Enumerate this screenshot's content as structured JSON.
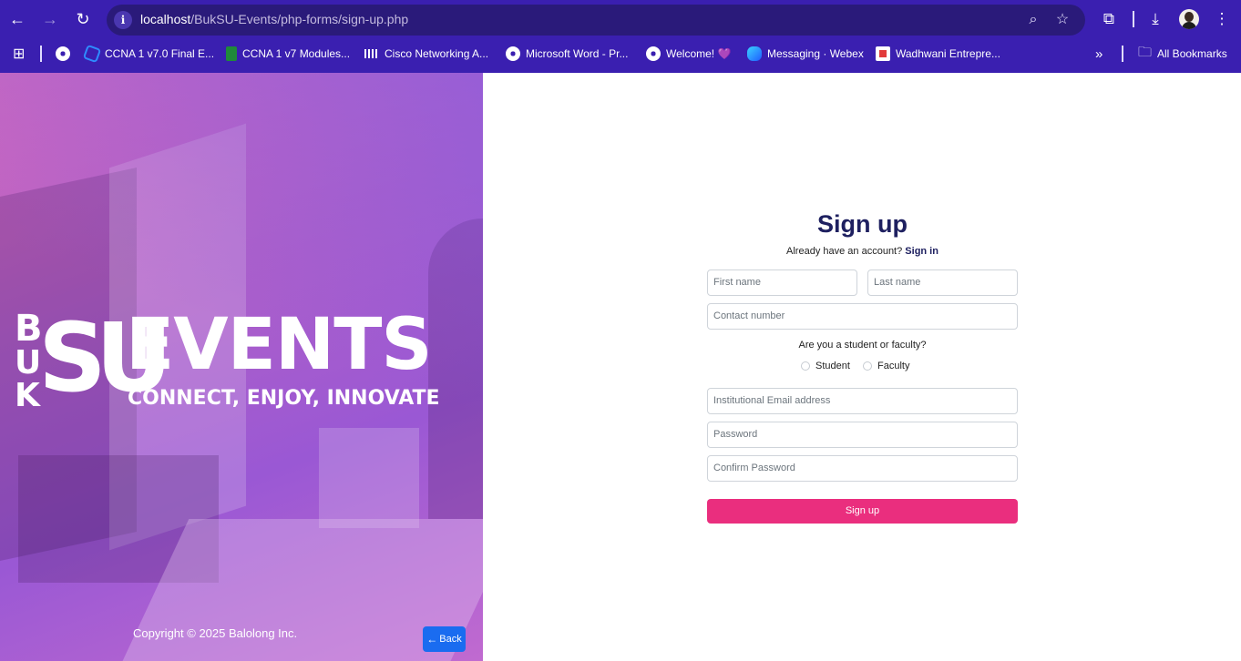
{
  "browser": {
    "url_host": "localhost",
    "url_path": "/BukSU-Events/php-forms/sign-up.php",
    "site_info_glyph": "i",
    "bookmarks": [
      {
        "label": "CCNA 1 v7.0 Final E...",
        "icon": "ccna-final-icon"
      },
      {
        "label": "CCNA 1 v7 Modules...",
        "icon": "ccna-modules-icon"
      },
      {
        "label": "Cisco Networking A...",
        "icon": "cisco-icon"
      },
      {
        "label": "Microsoft Word - Pr...",
        "icon": "globe-icon"
      },
      {
        "label": "Welcome! 💜",
        "icon": "globe-icon"
      },
      {
        "label": "Messaging · Webex",
        "icon": "webex-icon"
      },
      {
        "label": "Wadhwani Entrepre...",
        "icon": "wadhwani-icon"
      }
    ],
    "more_bookmarks": "»",
    "all_bookmarks": "All Bookmarks"
  },
  "hero": {
    "logo_letters": [
      "B",
      "U",
      "K",
      "SU"
    ],
    "logo_events": "EVENTS",
    "logo_tagline": "CONNECT, ENJOY, INNOVATE",
    "copyright": "Copyright © 2025 Balolong Inc.",
    "back_label": "Back"
  },
  "form": {
    "title": "Sign up",
    "have_account": "Already have an account?",
    "signin_link": "Sign in",
    "first_name_placeholder": "First name",
    "last_name_placeholder": "Last name",
    "contact_placeholder": "Contact number",
    "role_question": "Are you a student or faculty?",
    "role_options": [
      "Student",
      "Faculty"
    ],
    "email_placeholder": "Institutional Email address",
    "password_placeholder": "Password",
    "confirm_placeholder": "Confirm Password",
    "submit_label": "Sign up"
  },
  "colors": {
    "chrome_bg": "#3a1fb0",
    "title_navy": "#1e2060",
    "submit_pink": "#ea2e7e",
    "back_blue": "#1a6cf0"
  }
}
